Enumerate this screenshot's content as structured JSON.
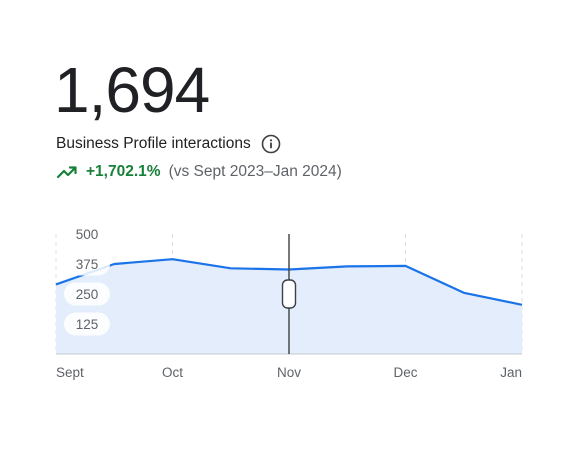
{
  "summary": {
    "total": "1,694",
    "label": "Business Profile interactions",
    "change": "+1,702.1%",
    "comparison": "(vs Sept 2023–Jan 2024)"
  },
  "icons": {
    "info": "info-icon",
    "trend": "trending-up-icon"
  },
  "colors": {
    "line": "#1a73e8",
    "area": "#e3edfb",
    "positive": "#188038",
    "cursor": "#3c4043"
  },
  "chart_data": {
    "type": "area",
    "categories": [
      "Sept",
      "Oct",
      "Nov",
      "Dec",
      "Jan"
    ],
    "x_points": [
      0,
      0.5,
      1,
      1.5,
      2,
      2.5,
      3,
      3.5,
      4
    ],
    "values": [
      290,
      375,
      395,
      357,
      352,
      365,
      367,
      255,
      205
    ],
    "y_ticks": [
      "500",
      "375",
      "250",
      "125"
    ],
    "ylim": [
      0,
      500
    ],
    "grid": "vertical dashed",
    "highlighted_category": "Nov"
  }
}
